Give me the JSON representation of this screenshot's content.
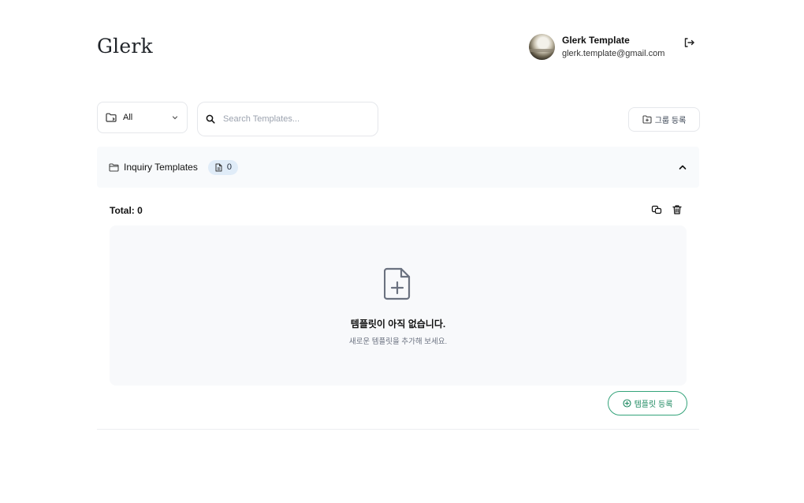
{
  "header": {
    "logo": "Glerk",
    "user": {
      "name": "Glerk Template",
      "email": "glerk.template@gmail.com"
    }
  },
  "toolbar": {
    "filter_label": "All",
    "search_placeholder": "Search Templates...",
    "group_register_label": "그룹 등록"
  },
  "section": {
    "title": "Inquiry Templates",
    "count": "0",
    "total_label": "Total: 0",
    "empty_title": "템플릿이 아직 없습니다.",
    "empty_subtitle": "새로운 템플릿을 추가해 보세요.",
    "add_template_label": "템플릿 등록"
  },
  "colors": {
    "accent_green": "#1f8a62",
    "badge_bg": "#e0ecf8",
    "section_bg": "#f8fafc"
  },
  "icons": [
    "logout-icon",
    "folder-icon",
    "chevron-down-icon",
    "search-icon",
    "folder-plus-icon",
    "folder-icon",
    "file-icon",
    "chevron-up-icon",
    "copy-icon",
    "trash-icon",
    "file-plus-icon",
    "plus-circle-icon"
  ]
}
